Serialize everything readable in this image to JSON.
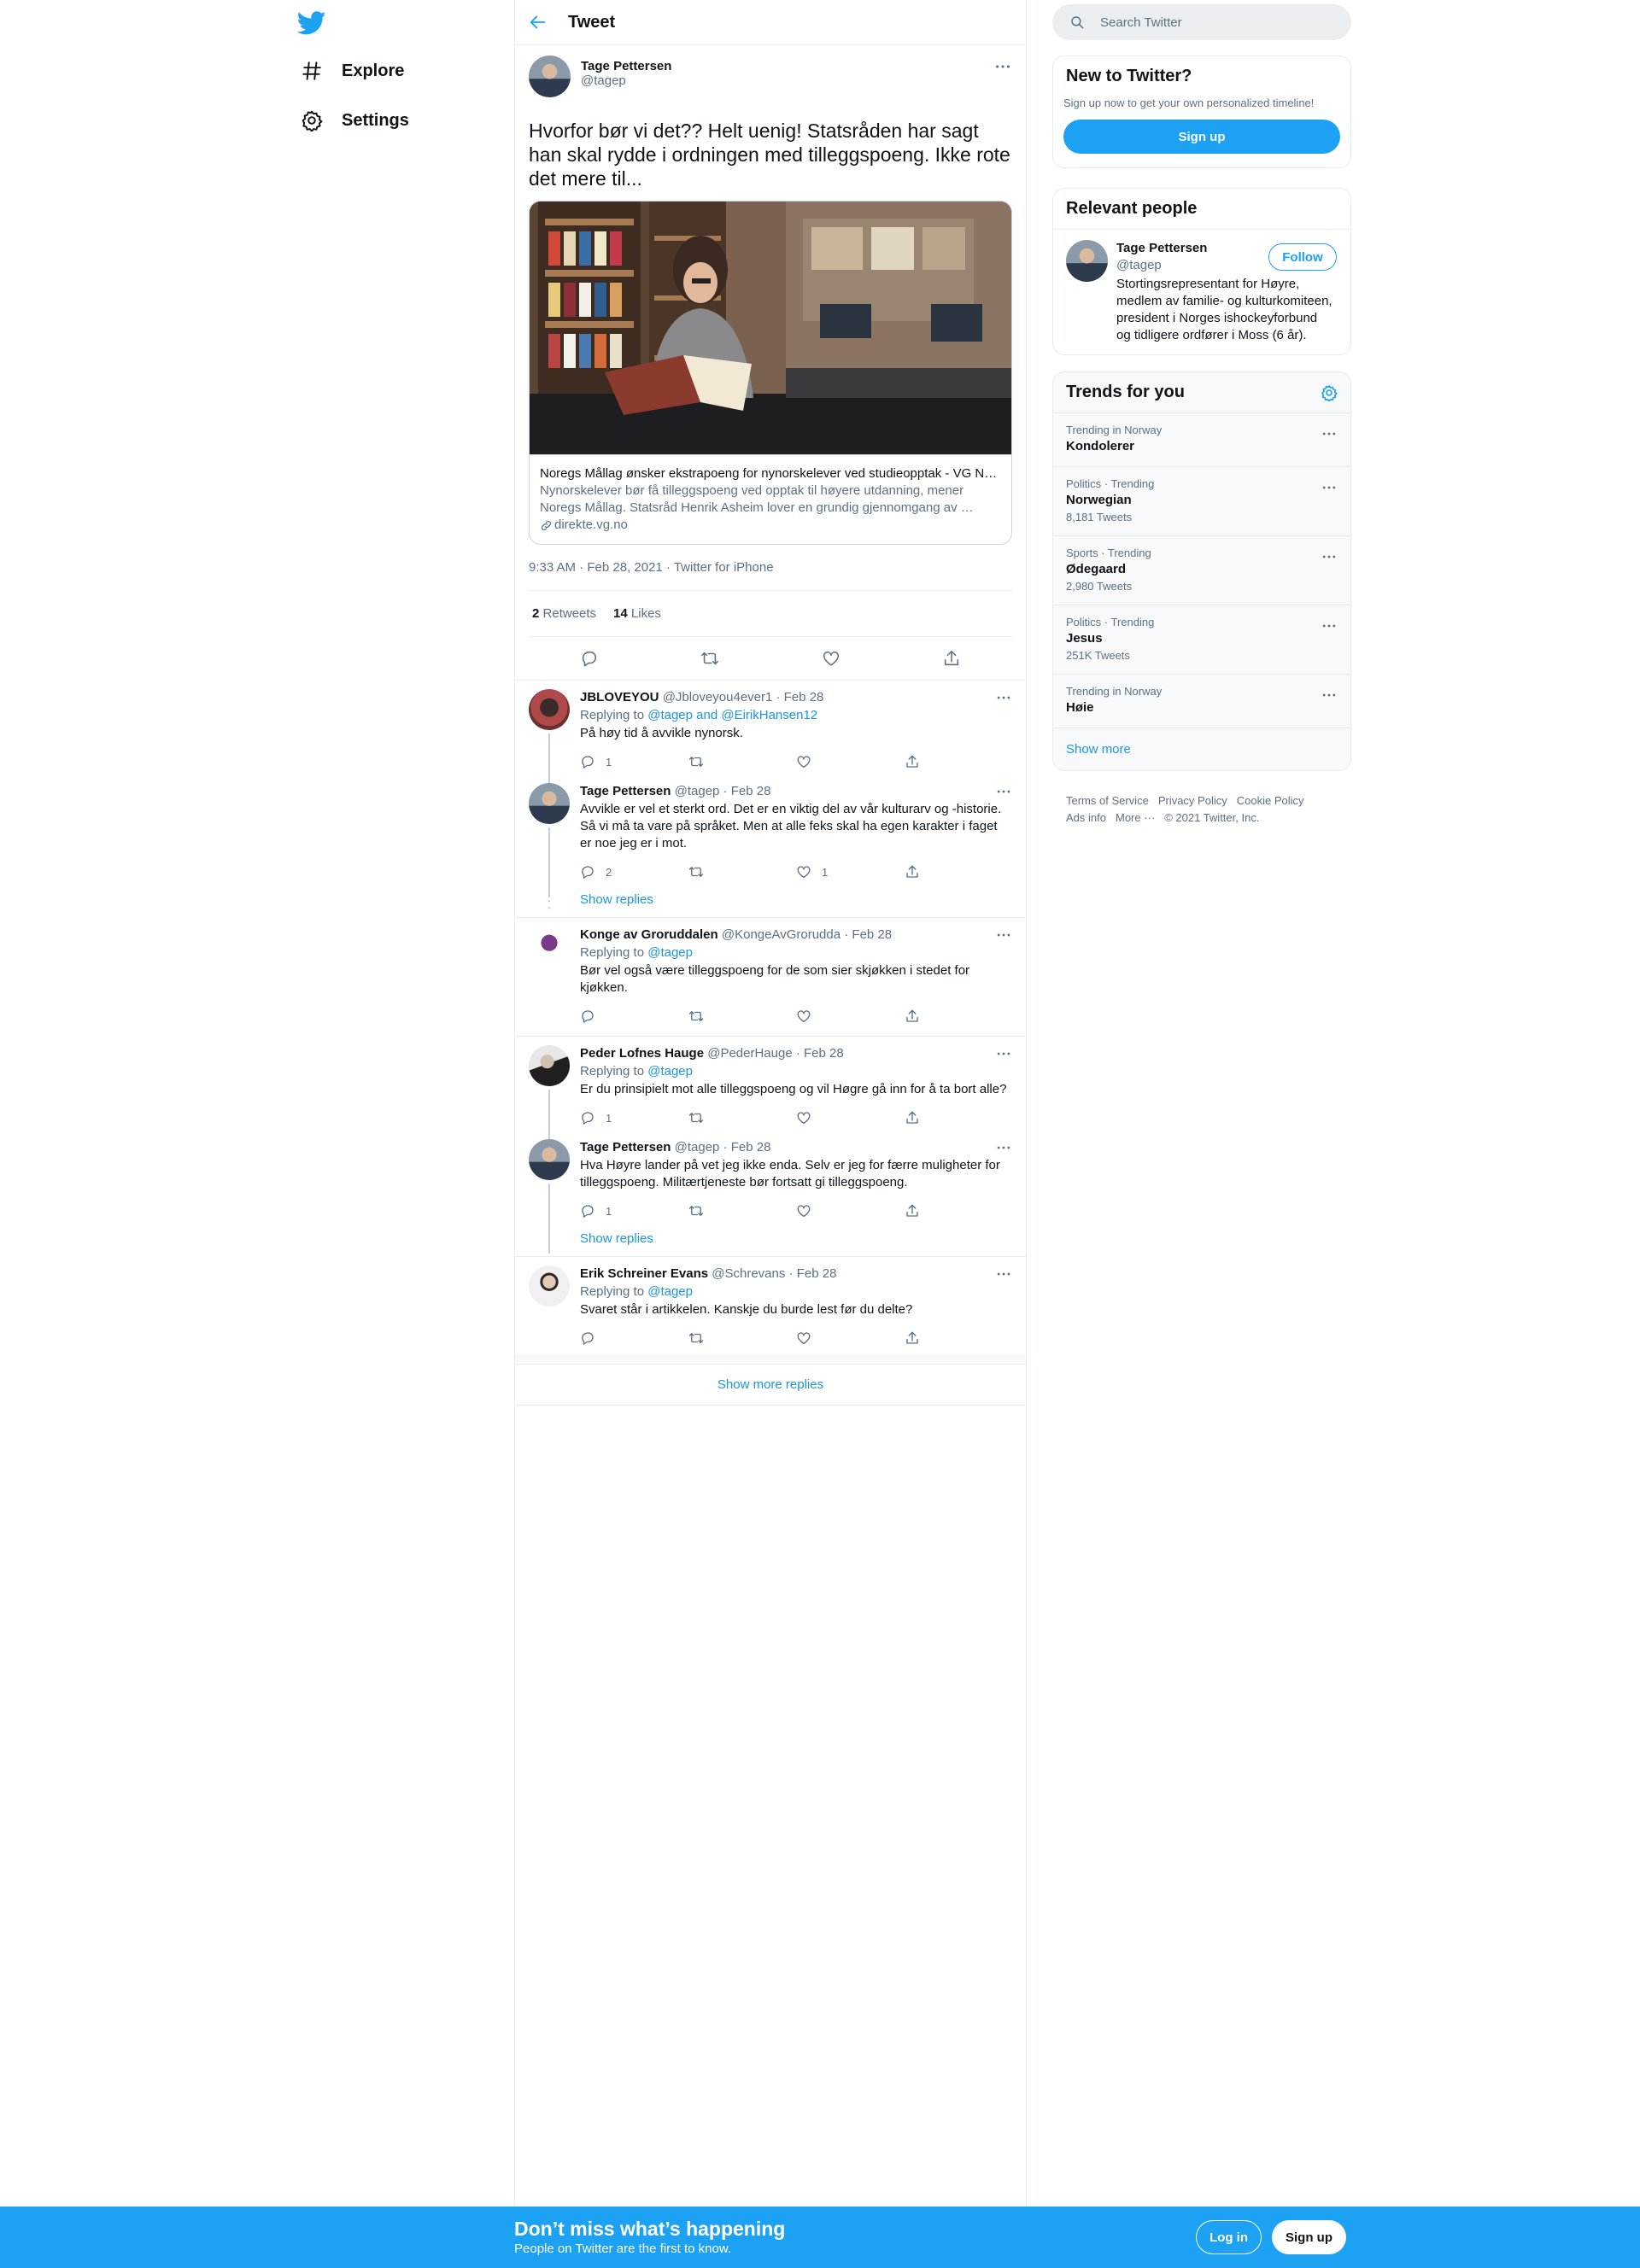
{
  "nav": {
    "items": [
      {
        "label": "Explore"
      },
      {
        "label": "Settings"
      }
    ]
  },
  "header": {
    "title": "Tweet"
  },
  "tweet": {
    "name": "Tage Pettersen",
    "handle": "@tagep",
    "text": "Hvorfor bør vi det?? Helt uenig! Statsråden har sagt han skal rydde i ordningen med tilleggspoeng. Ikke rote det mere til...",
    "card": {
      "title": "Noregs Mållag ønsker ekstrapoeng for nynorskelever ved studieopptak - VG Nyheter Direkte",
      "description_line1": "Nynorskelever bør få tilleggspoeng ved opptak til høyere utdanning, mener",
      "description_line2": "Noregs Mållag. Statsråd Henrik Asheim lover en grundig gjennomgang av …",
      "domain": "direkte.vg.no"
    },
    "timestamp": "9:33 AM · Feb 28, 2021 · Twitter for iPhone",
    "retweets": "2",
    "retweets_label": "Retweets",
    "likes": "14",
    "likes_label": "Likes"
  },
  "replies": [
    {
      "name": "JBLOVEYOU",
      "handle": "@Jbloveyou4ever1",
      "time": "· Feb 28",
      "replying_prefix": "Replying to ",
      "replying_to": "@tagep and @EirikHansen12",
      "text": "På høy tid å avvikle nynorsk.",
      "reply_count": "1",
      "retweet_count": "",
      "like_count": ""
    },
    {
      "name": "Tage Pettersen",
      "handle": "@tagep",
      "time": "· Feb 28",
      "text": "Avvikle er vel et sterkt ord. Det er en viktig del av vår kulturarv og -historie. Så vi må ta vare på språket. Men at alle feks skal ha egen karakter  i faget er noe jeg er i mot.",
      "reply_count": "2",
      "retweet_count": "",
      "like_count": "1",
      "show_replies": "Show replies"
    },
    {
      "name": "Konge av Groruddalen",
      "handle": "@KongeAvGrorudda",
      "time": "· Feb 28",
      "replying_prefix": "Replying to ",
      "replying_to": "@tagep",
      "text": "Bør vel også være tilleggspoeng for de som sier skjøkken i stedet for kjøkken.",
      "reply_count": "",
      "retweet_count": "",
      "like_count": ""
    },
    {
      "name": "Peder Lofnes Hauge",
      "handle": "@PederHauge",
      "time": "· Feb 28",
      "replying_prefix": "Replying to ",
      "replying_to": "@tagep",
      "text": "Er du prinsipielt mot alle tilleggspoeng og vil Høgre gå inn for å ta bort alle?",
      "reply_count": "1",
      "retweet_count": "",
      "like_count": ""
    },
    {
      "name": "Tage Pettersen",
      "handle": "@tagep",
      "time": "· Feb 28",
      "text": "Hva Høyre lander på vet jeg ikke enda. Selv er jeg for færre muligheter for tilleggspoeng. Militærtjeneste bør fortsatt gi tilleggspoeng.",
      "reply_count": "1",
      "retweet_count": "",
      "like_count": "",
      "show_replies": "Show replies"
    },
    {
      "name": "Erik Schreiner Evans",
      "handle": "@Schrevans",
      "time": "· Feb 28",
      "replying_prefix": "Replying to ",
      "replying_to": "@tagep",
      "text": "Svaret står i artikkelen. Kanskje du burde lest før du delte?",
      "reply_count": "",
      "retweet_count": "",
      "like_count": ""
    }
  ],
  "show_more_replies": "Show more replies",
  "search": {
    "placeholder": "Search Twitter"
  },
  "new_to_twitter": {
    "title": "New to Twitter?",
    "subtitle": "Sign up now to get your own personalized timeline!",
    "button": "Sign up"
  },
  "relevant_people": {
    "title": "Relevant people",
    "person": {
      "name": "Tage Pettersen",
      "handle": "@tagep",
      "follow": "Follow",
      "bio": "Stortingsrepresentant for Høyre, medlem av familie- og kulturkomiteen, president i Norges ishockeyforbund og tidligere ordfører i Moss (6 år)."
    }
  },
  "trends": {
    "title": "Trends for you",
    "items": [
      {
        "context": "Trending in Norway",
        "name": "Kondolerer",
        "count": ""
      },
      {
        "context": "Politics · Trending",
        "name": "Norwegian",
        "count": "8,181 Tweets"
      },
      {
        "context": "Sports · Trending",
        "name": "Ødegaard",
        "count": "2,980 Tweets"
      },
      {
        "context": "Politics · Trending",
        "name": "Jesus",
        "count": "251K Tweets"
      },
      {
        "context": "Trending in Norway",
        "name": "Høie",
        "count": ""
      }
    ],
    "show_more": "Show more"
  },
  "footer": {
    "links": [
      "Terms of Service",
      "Privacy Policy",
      "Cookie Policy",
      "Ads info",
      "More ···",
      "© 2021 Twitter, Inc."
    ]
  },
  "bottom_bar": {
    "headline": "Don’t miss what’s happening",
    "subline": "People on Twitter are the first to know.",
    "login": "Log in",
    "signup": "Sign up"
  },
  "colors": {
    "accent": "#1da1f2",
    "link": "#1b95e0",
    "muted": "#5b7083",
    "border": "#e6ecf0"
  },
  "icons": [
    "twitter-logo-icon",
    "hashtag-icon",
    "gear-icon",
    "back-arrow-icon",
    "more-dots-icon",
    "reply-icon",
    "retweet-icon",
    "like-icon",
    "share-icon",
    "link-icon",
    "search-icon"
  ]
}
